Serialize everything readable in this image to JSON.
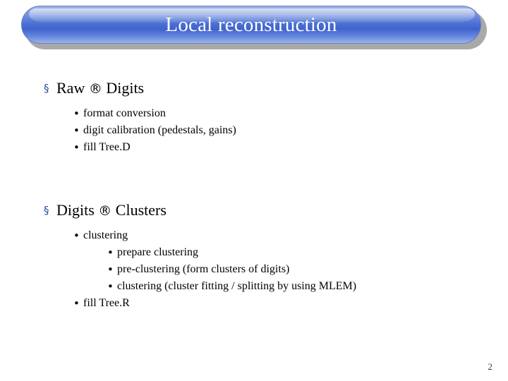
{
  "slide": {
    "title": "Local reconstruction",
    "page_number": "2",
    "theme": {
      "title_bar_color": "#4a6fd4",
      "title_text_color": "#ffffff",
      "level1_bullet_color": "#2b4a9e",
      "body_text_color": "#000000"
    },
    "blocks": [
      {
        "heading": {
          "bullet": "§",
          "text_before_arrow": "Raw ",
          "arrow": "®",
          "text_after_arrow": " Digits"
        },
        "items": [
          {
            "bullet": "•",
            "text": "format conversion"
          },
          {
            "bullet": "•",
            "text": "digit calibration (pedestals, gains)"
          },
          {
            "bullet": "•",
            "text": "fill Tree.D"
          }
        ]
      },
      {
        "heading": {
          "bullet": "§",
          "text_before_arrow": "Digits ",
          "arrow": "®",
          "text_after_arrow": " Clusters"
        },
        "items": [
          {
            "bullet": "•",
            "text": "clustering"
          }
        ],
        "subitems": [
          {
            "bullet": "•",
            "text": "prepare clustering"
          },
          {
            "bullet": "•",
            "text": "pre-clustering (form clusters of digits)"
          },
          {
            "bullet": "•",
            "text": "clustering (cluster fitting / splitting by using MLEM)"
          }
        ],
        "items_after": [
          {
            "bullet": "•",
            "text": "fill Tree.R"
          }
        ]
      }
    ]
  }
}
